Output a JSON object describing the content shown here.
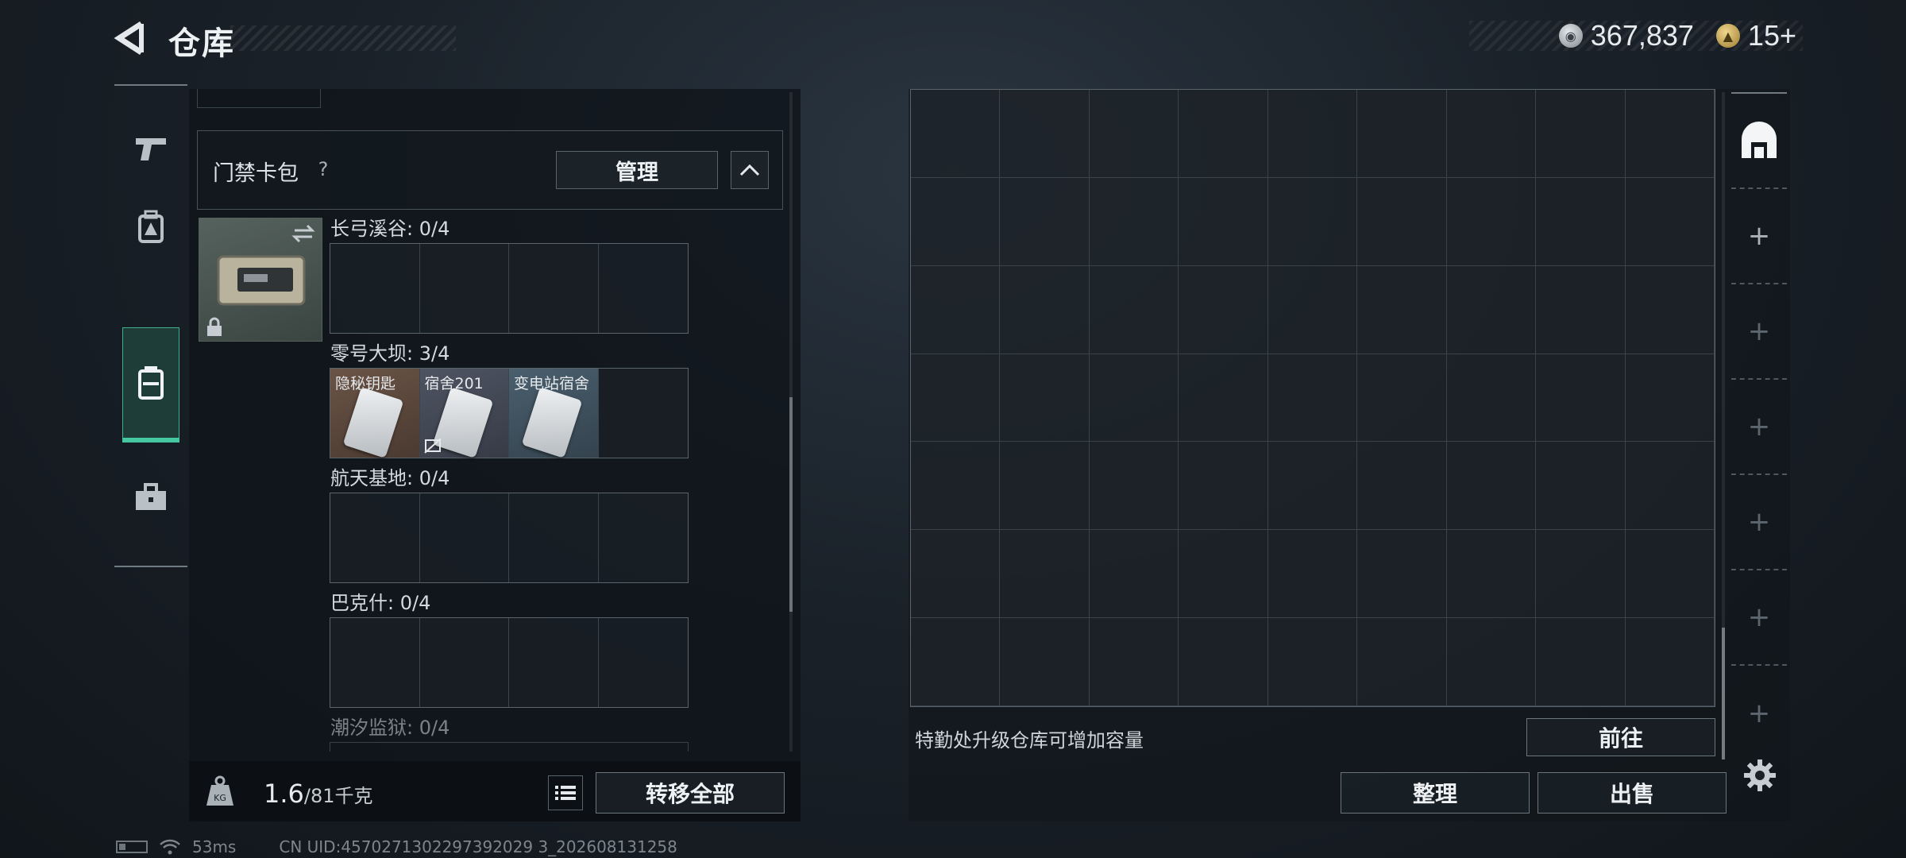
{
  "header": {
    "title": "仓库",
    "currency_silver": "367,837",
    "currency_gold": "15+"
  },
  "left_nav": {
    "items": [
      {
        "icon": "pistol-icon",
        "active": false
      },
      {
        "icon": "backpack-icon",
        "active": false
      },
      {
        "icon": "keycard-case-icon",
        "active": true
      },
      {
        "icon": "toolbox-icon",
        "active": false
      }
    ]
  },
  "keycard_panel": {
    "label": "门禁卡包",
    "help": "?",
    "manage_label": "管理",
    "sections": [
      {
        "label": "长弓溪谷: 0/4",
        "slots": [
          "",
          "",
          "",
          ""
        ]
      },
      {
        "label": "零号大坝: 3/4",
        "slots": [
          "隐秘钥匙",
          "宿舍201",
          "变电站宿舍",
          ""
        ]
      },
      {
        "label": "航天基地: 0/4",
        "slots": [
          "",
          "",
          "",
          ""
        ]
      },
      {
        "label": "巴克什: 0/4",
        "slots": [
          "",
          "",
          "",
          ""
        ]
      },
      {
        "label": "潮汐监狱: 0/4",
        "slots": []
      }
    ]
  },
  "bottom_left": {
    "weight_current": "1.6",
    "weight_max": "/81千克",
    "transfer_all_label": "转移全部"
  },
  "storage": {
    "columns": 9,
    "rows": 7,
    "upgrade_hint": "特勤处升级仓库可增加容量",
    "goto_label": "前往",
    "tidy_label": "整理",
    "sell_label": "出售"
  },
  "status_bar": {
    "ping": "53ms",
    "uid": "CN UID:4570271302297392029 3_202608131258"
  },
  "colors": {
    "accent_green": "#45c89f",
    "panel_bg": "#10151b"
  }
}
